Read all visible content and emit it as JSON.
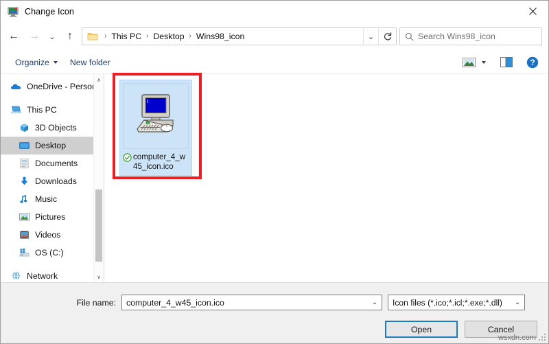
{
  "window": {
    "title": "Change Icon",
    "title_icon": "monitor-icon",
    "close_label": "✕"
  },
  "nav": {
    "back_icon": "back-arrow-icon",
    "forward_icon": "forward-arrow-icon",
    "history_icon": "chevron-down-icon",
    "up_icon": "up-arrow-icon",
    "back_glyph": "←",
    "forward_glyph": "→",
    "history_glyph": "⌄",
    "up_glyph": "↑",
    "breadcrumbs": [
      {
        "label": "This PC"
      },
      {
        "label": "Desktop"
      },
      {
        "label": "Wins98_icon"
      }
    ],
    "separator": "›",
    "address_chevron": "⌄",
    "refresh_icon": "refresh-icon"
  },
  "search": {
    "placeholder": "Search Wins98_icon",
    "icon": "search-icon"
  },
  "command_bar": {
    "organize_label": "Organize",
    "new_folder_label": "New folder",
    "view_icon": "view-thumbnails-icon",
    "view_caret_icon": "chevron-down-icon",
    "preview_pane_icon": "preview-pane-icon",
    "help_icon": "help-icon",
    "help_glyph": "?"
  },
  "sidebar": {
    "items": [
      {
        "label": "OneDrive - Person",
        "icon": "onedrive-cloud-icon",
        "indent": 0,
        "selected": false
      },
      {
        "label": "This PC",
        "icon": "this-pc-icon",
        "indent": 0,
        "selected": false
      },
      {
        "label": "3D Objects",
        "icon": "3d-objects-icon",
        "indent": 1,
        "selected": false
      },
      {
        "label": "Desktop",
        "icon": "desktop-icon",
        "indent": 1,
        "selected": true
      },
      {
        "label": "Documents",
        "icon": "documents-icon",
        "indent": 1,
        "selected": false
      },
      {
        "label": "Downloads",
        "icon": "downloads-icon",
        "indent": 1,
        "selected": false
      },
      {
        "label": "Music",
        "icon": "music-icon",
        "indent": 1,
        "selected": false
      },
      {
        "label": "Pictures",
        "icon": "pictures-icon",
        "indent": 1,
        "selected": false
      },
      {
        "label": "Videos",
        "icon": "videos-icon",
        "indent": 1,
        "selected": false
      },
      {
        "label": "OS (C:)",
        "icon": "os-drive-icon",
        "indent": 1,
        "selected": false
      },
      {
        "label": "Network",
        "icon": "network-icon",
        "indent": 0,
        "selected": false
      }
    ],
    "scroll_up_glyph": "∧",
    "scroll_down_glyph": "∨"
  },
  "file_list": {
    "items": [
      {
        "name": "computer_4_w45_icon.ico",
        "icon": "windows-98-computer-icon",
        "selected": true,
        "badge": "green-check-icon"
      }
    ]
  },
  "footer": {
    "file_name_label": "File name:",
    "file_name_value": "computer_4_w45_icon.ico",
    "file_name_chevron": "⌄",
    "file_type_value": "Icon files (*.ico;*.icl;*.exe;*.dll)",
    "file_type_chevron": "⌄",
    "open_label": "Open",
    "cancel_label": "Cancel",
    "watermark": "wsxdn.com"
  },
  "colors": {
    "accent": "#1f7bc1",
    "selection": "#cde3f7",
    "annotation": "#ee1c25",
    "tree_selected": "#cfcfcf",
    "footer_bg": "#f0f0f0"
  }
}
